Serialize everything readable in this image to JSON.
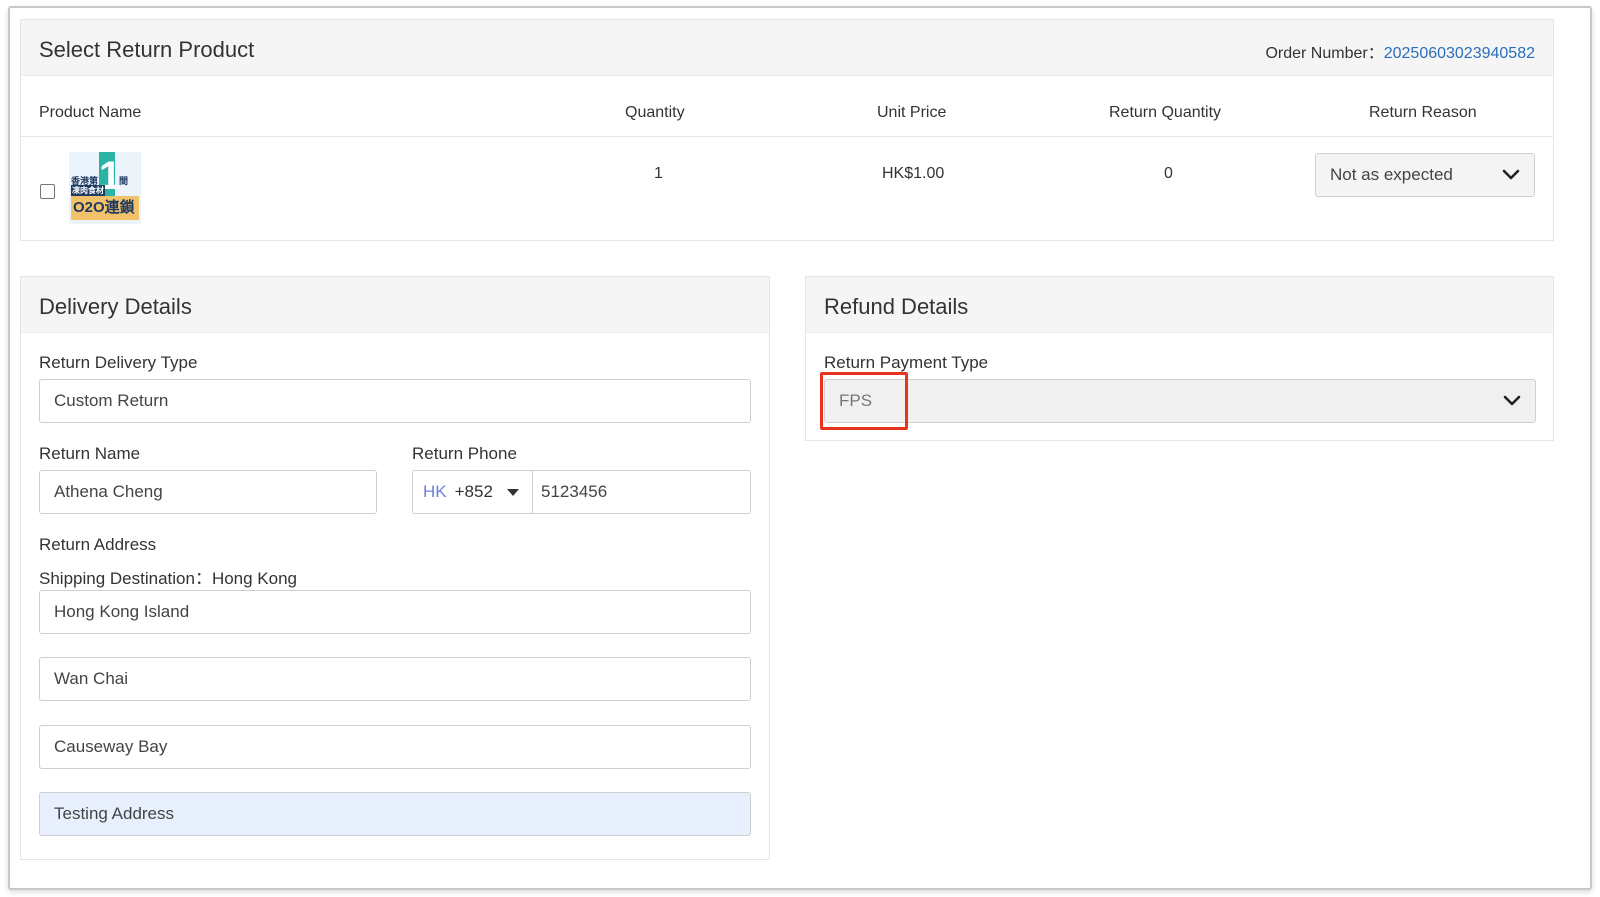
{
  "select_product": {
    "title": "Select Return Product",
    "order_number_label": "Order Number：",
    "order_number": "20250603023940582",
    "columns": [
      "Product Name",
      "Quantity",
      "Unit Price",
      "Return Quantity",
      "Return Reason"
    ],
    "rows": [
      {
        "checked": false,
        "thumbnail_text": {
          "line1": "香港第",
          "digit": "1",
          "line2": "凍肉食材",
          "side": "間",
          "brand": "O2O連鎖"
        },
        "quantity": "1",
        "unit_price": "HK$1.00",
        "return_quantity": "0",
        "return_reason": "Not as expected"
      }
    ]
  },
  "delivery": {
    "title": "Delivery Details",
    "delivery_type_label": "Return Delivery Type",
    "delivery_type_value": "Custom Return",
    "name_label": "Return Name",
    "name_value": "Athena Cheng",
    "phone_label": "Return Phone",
    "phone_country": "HK",
    "phone_code": "+852",
    "phone_number": "5123456",
    "address_label": "Return Address",
    "shipping_destination": "Shipping Destination：Hong Kong",
    "address_lines": [
      "Hong Kong Island",
      "Wan Chai",
      "Causeway Bay",
      "Testing Address"
    ]
  },
  "refund": {
    "title": "Refund Details",
    "payment_type_label": "Return Payment Type",
    "payment_type_value": "FPS"
  },
  "icons": {
    "dropdown": "chevron-down-icon",
    "phone_dropdown": "caret-down-icon"
  },
  "colors": {
    "link": "#2a6ebb",
    "highlight_border": "#e8331e",
    "autofill_bg": "#e8f0fe",
    "country_code": "#6b7fe0"
  }
}
